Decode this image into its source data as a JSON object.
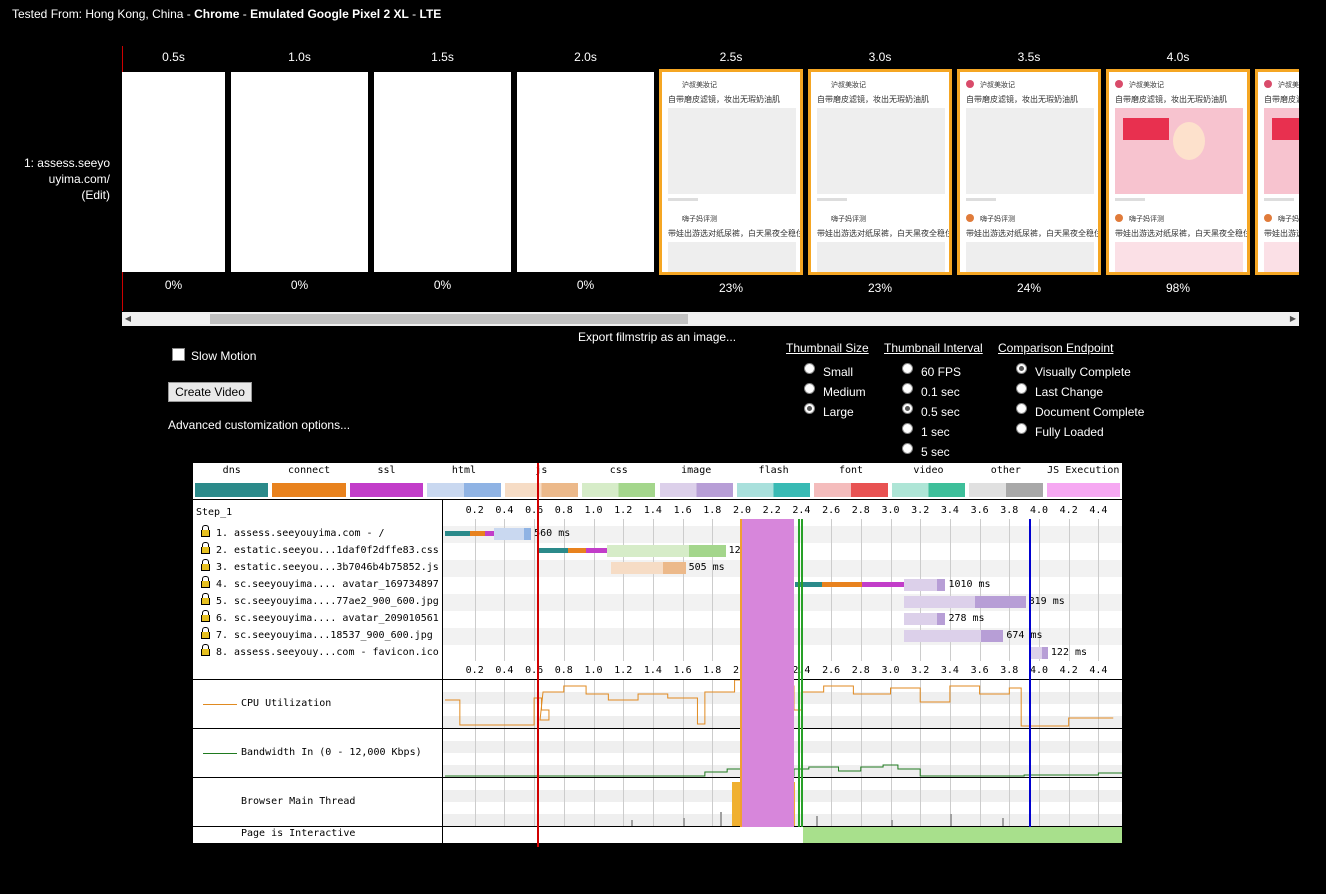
{
  "header": {
    "tested_prefix": "Tested From: Hong Kong, China - ",
    "browser": "Chrome",
    "sep1": " - ",
    "device": "Emulated Google Pixel 2 XL",
    "sep2": " - ",
    "network": "LTE"
  },
  "filmstrip": {
    "url_label": "1: assess.seeyo uyima.com/",
    "edit_label": "(Edit)",
    "frames": [
      {
        "time": "0.5s",
        "pct": "0%",
        "changed": false,
        "content": "blank"
      },
      {
        "time": "1.0s",
        "pct": "0%",
        "changed": false,
        "content": "blank"
      },
      {
        "time": "1.5s",
        "pct": "0%",
        "changed": false,
        "content": "blank"
      },
      {
        "time": "2.0s",
        "pct": "0%",
        "changed": false,
        "content": "blank"
      },
      {
        "time": "2.5s",
        "pct": "23%",
        "changed": true,
        "content": "text"
      },
      {
        "time": "3.0s",
        "pct": "23%",
        "changed": true,
        "content": "text"
      },
      {
        "time": "3.5s",
        "pct": "24%",
        "changed": true,
        "content": "avatar"
      },
      {
        "time": "4.0s",
        "pct": "98%",
        "changed": true,
        "content": "image"
      },
      {
        "time": "",
        "pct": "",
        "changed": true,
        "content": "image"
      }
    ],
    "thumb_texts": {
      "author1": "沪叔美妝记",
      "title1": "自带磨皮滤镜，妆出无瑕奶油肌",
      "author2": "嗨子妈评测",
      "title2": "带娃出游选对纸尿裤，白天黑夜全稳住"
    }
  },
  "controls": {
    "export_label": "Export filmstrip as an image...",
    "slow_motion_label": "Slow Motion",
    "create_video_label": "Create Video",
    "advanced_label": "Advanced customization options...",
    "thumbnail_size": {
      "title": "Thumbnail Size",
      "options": [
        "Small",
        "Medium",
        "Large"
      ],
      "selected": "Large"
    },
    "thumbnail_interval": {
      "title": "Thumbnail Interval",
      "options": [
        "60 FPS",
        "0.1 sec",
        "0.5 sec",
        "1 sec",
        "5 sec"
      ],
      "selected": "0.5 sec"
    },
    "comparison_endpoint": {
      "title": "Comparison Endpoint",
      "options": [
        "Visually Complete",
        "Last Change",
        "Document Complete",
        "Fully Loaded"
      ],
      "selected": "Visually Complete"
    }
  },
  "waterfall": {
    "legend": [
      {
        "name": "dns",
        "c1": "#2b8a8a",
        "c2": "#2b8a8a"
      },
      {
        "name": "connect",
        "c1": "#e8821e",
        "c2": "#e8821e"
      },
      {
        "name": "ssl",
        "c1": "#c23dc9",
        "c2": "#c23dc9"
      },
      {
        "name": "html",
        "c1": "#c9d8f0",
        "c2": "#8fb3e4"
      },
      {
        "name": "js",
        "c1": "#f6dcc5",
        "c2": "#ecb98a"
      },
      {
        "name": "css",
        "c1": "#d6ecc8",
        "c2": "#a4d68c"
      },
      {
        "name": "image",
        "c1": "#dcd0ea",
        "c2": "#b79ed6"
      },
      {
        "name": "flash",
        "c1": "#a9e0dc",
        "c2": "#38bab4"
      },
      {
        "name": "font",
        "c1": "#f4bcbc",
        "c2": "#e85252"
      },
      {
        "name": "video",
        "c1": "#aee5d6",
        "c2": "#3ebf9a"
      },
      {
        "name": "other",
        "c1": "#e0e0e0",
        "c2": "#a8a8a8"
      },
      {
        "name": "JS Execution",
        "c1": "#f6a8f2",
        "c2": "#f6a8f2"
      }
    ],
    "step_label": "Step_1",
    "ticks": [
      "0.2",
      "0.4",
      "0.6",
      "0.8",
      "1.0",
      "1.2",
      "1.4",
      "1.6",
      "1.8",
      "2.0",
      "2.2",
      "2.4",
      "2.6",
      "2.8",
      "3.0",
      "3.2",
      "3.4",
      "3.6",
      "3.8",
      "4.0",
      "4.2",
      "4.4"
    ],
    "requests": [
      {
        "label": "1. assess.seeyouyima.com - /",
        "ms": "560 ms",
        "start": 0.0,
        "dns": 0.17,
        "connect": 0.1,
        "ssl": 0.06,
        "wait": 0.2,
        "recv": 0.05,
        "type": "html"
      },
      {
        "label": "2. estatic.seeyou...1daf0f2dffe83.css",
        "ms": "1271 ms",
        "start": 0.63,
        "dns": 0.2,
        "connect": 0.12,
        "ssl": 0.14,
        "wait": 0.55,
        "recv": 0.25,
        "type": "css"
      },
      {
        "label": "3. estatic.seeyou...3b7046b4b75852.js",
        "ms": "505 ms",
        "start": 1.12,
        "dns": 0,
        "connect": 0,
        "ssl": 0,
        "wait": 0.35,
        "recv": 0.15,
        "type": "js"
      },
      {
        "label": "4. sc.seeyouyima.... avatar_169734897",
        "ms": "1010 ms",
        "start": 2.36,
        "dns": 0.18,
        "connect": 0.27,
        "ssl": 0.28,
        "wait": 0.22,
        "recv": 0.06,
        "type": "image"
      },
      {
        "label": "5. sc.seeyouyima....77ae2_900_600.jpg",
        "ms": "819 ms",
        "start": 3.09,
        "dns": 0,
        "connect": 0,
        "ssl": 0,
        "wait": 0.48,
        "recv": 0.34,
        "type": "image"
      },
      {
        "label": "6. sc.seeyouyima.... avatar_209010561",
        "ms": "278 ms",
        "start": 3.09,
        "dns": 0,
        "connect": 0,
        "ssl": 0,
        "wait": 0.22,
        "recv": 0.06,
        "type": "image"
      },
      {
        "label": "7. sc.seeyouyima...18537_900_600.jpg",
        "ms": "674 ms",
        "start": 3.09,
        "dns": 0,
        "connect": 0,
        "ssl": 0,
        "wait": 0.52,
        "recv": 0.15,
        "type": "image"
      },
      {
        "label": "8. assess.seeyouy...com - favicon.ico",
        "ms": "122 ms",
        "start": 3.93,
        "dns": 0,
        "connect": 0,
        "ssl": 0,
        "wait": 0.09,
        "recv": 0.04,
        "type": "image"
      }
    ],
    "cpu_label": "CPU Utilization",
    "bandwidth_label": "Bandwidth In (0 - 12,000 Kbps)",
    "main_thread_label": "Browser Main Thread",
    "interactive_label": "Page is Interactive",
    "interactive_from": 2.41,
    "markers": {
      "start_render": 0.62,
      "dom_content": 2.0,
      "load_event": [
        2.38,
        2.4
      ],
      "visually_complete": 3.93
    },
    "colors": {
      "start_render": "#d00000",
      "dom_interactive": "#f0a030",
      "dom_content": "#d786db",
      "load_event": "#28a028",
      "visual_complete": "#0000d0",
      "cpu": "#e08a20",
      "bandwidth": "#1f7a1f",
      "interactive": "#a8e08c"
    }
  }
}
